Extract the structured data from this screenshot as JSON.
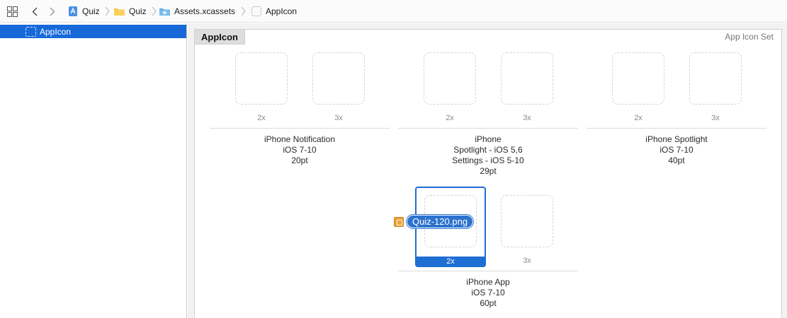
{
  "breadcrumb": {
    "items": [
      {
        "label": "Quiz",
        "icon": "project-file-icon"
      },
      {
        "label": "Quiz",
        "icon": "folder-icon"
      },
      {
        "label": "Assets.xcassets",
        "icon": "asset-catalog-icon"
      },
      {
        "label": "AppIcon",
        "icon": "appicon-set-icon"
      }
    ]
  },
  "outline": {
    "items": [
      {
        "label": "AppIcon",
        "selected": true
      }
    ]
  },
  "editor": {
    "title": "AppIcon",
    "set_type": "App Icon Set",
    "groups": [
      {
        "scales": [
          "2x",
          "3x"
        ],
        "lines": [
          "iPhone Notification",
          "iOS 7-10",
          "20pt"
        ]
      },
      {
        "scales": [
          "2x",
          "3x"
        ],
        "lines": [
          "iPhone",
          "Spotlight - iOS 5,6",
          "Settings - iOS 5-10",
          "29pt"
        ]
      },
      {
        "scales": [
          "2x",
          "3x"
        ],
        "lines": [
          "iPhone Spotlight",
          "iOS 7-10",
          "40pt"
        ]
      },
      {
        "scales": [
          "2x",
          "3x"
        ],
        "lines": [
          "iPhone App",
          "iOS 7-10",
          "60pt"
        ],
        "selected_scale": "2x"
      }
    ],
    "drag_file": "Quiz-120.png"
  },
  "colors": {
    "selection": "#1769d9",
    "drop_target": "#1f6ed4",
    "folder": "#f3c23a"
  }
}
